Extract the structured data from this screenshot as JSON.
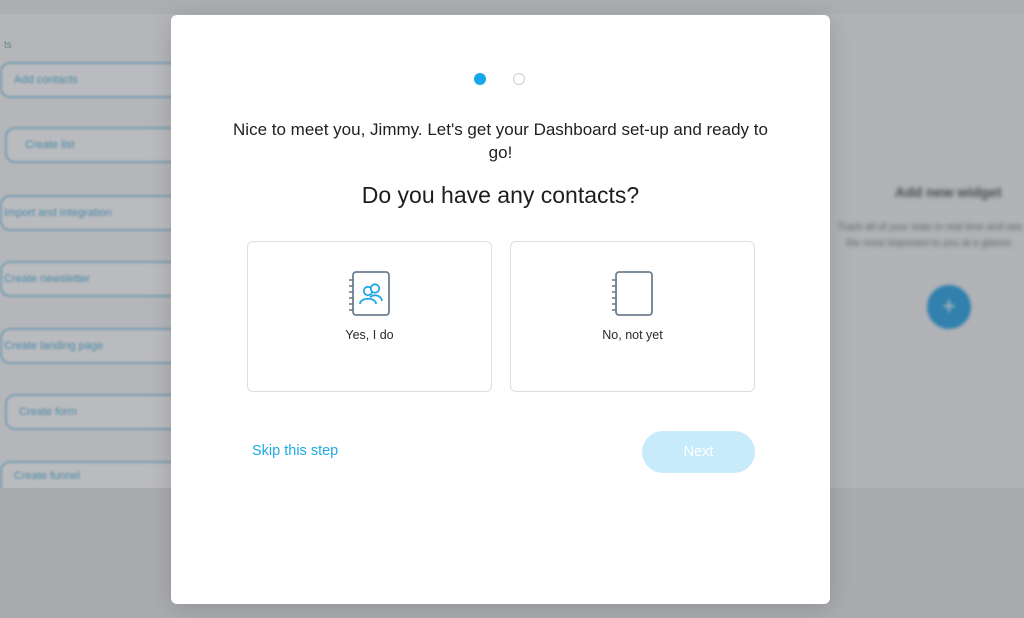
{
  "background": {
    "sidebar_header": "ts",
    "sidebar_items": [
      "Add contacts",
      "Create list",
      "Import and Integration",
      "Create newsletter",
      "Create landing page",
      "Create form",
      "Create funnel"
    ],
    "widget_title": "Add new widget",
    "widget_description": "Track all of your stats in real time and see the most important to you at a glance.",
    "add_widget_icon": "plus-icon"
  },
  "modal": {
    "stepper": {
      "total": 2,
      "current": 1
    },
    "intro_text": "Nice to meet you, Jimmy. Let's get your Dashboard set-up and ready to go!",
    "question": "Do you have any contacts?",
    "options": [
      {
        "label": "Yes, I do",
        "icon": "address-book-contacts-icon"
      },
      {
        "label": "No, not yet",
        "icon": "empty-notebook-icon"
      }
    ],
    "skip_label": "Skip this step",
    "next_label": "Next"
  },
  "colors": {
    "accent": "#13a8e9",
    "next_disabled_bg": "#c7ebfa",
    "icon_accent": "#21a8e4",
    "icon_stroke": "#6e7f91"
  }
}
